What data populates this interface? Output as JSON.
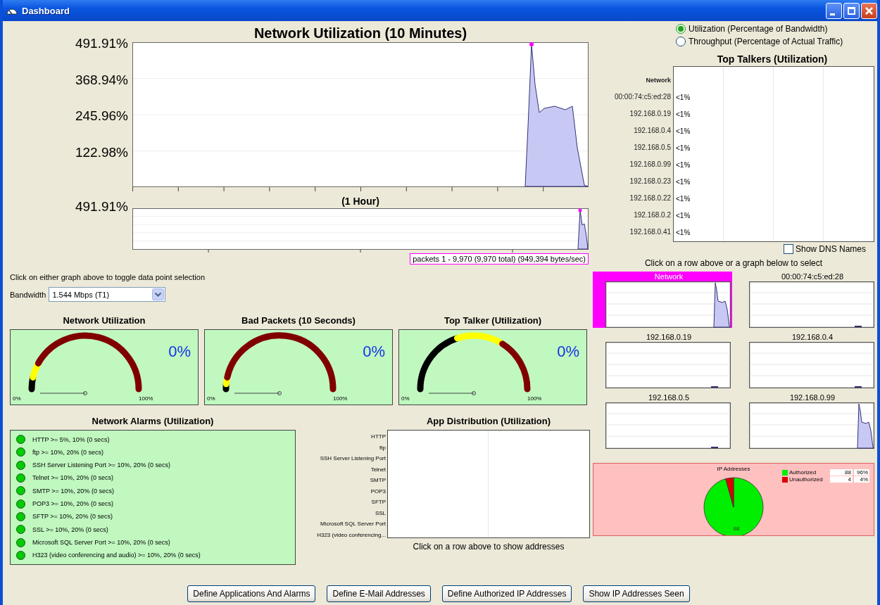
{
  "window": {
    "title": "Dashboard"
  },
  "utilization_chart": {
    "title": "Network Utilization (10 Minutes)",
    "y_labels": [
      "491.91%",
      "368.94%",
      "245.96%",
      "122.98%"
    ]
  },
  "hour_chart": {
    "title": "(1 Hour)",
    "y_labels": [
      "491.91%"
    ],
    "selection": "packets 1 - 9,970 (9,970 total) (949,394 bytes/sec)"
  },
  "hint": "Click on either graph above to toggle data point selection",
  "bandwidth": {
    "label": "Bandwidth",
    "value": "1.544 Mbps (T1)"
  },
  "gauges": [
    {
      "title": "Network Utilization",
      "value": "0%",
      "min_label": "0%",
      "max_label": "100%",
      "kind": "low"
    },
    {
      "title": "Bad Packets (10 Seconds)",
      "value": "0%",
      "min_label": "0%",
      "max_label": "100%",
      "kind": "tight"
    },
    {
      "title": "Top Talker (Utilization)",
      "value": "0%",
      "min_label": "0%",
      "max_label": "100%",
      "kind": "wide"
    }
  ],
  "alarms": {
    "title": "Network Alarms (Utilization)",
    "items": [
      "HTTP >= 5%, 10% (0 secs)",
      "ftp >= 10%, 20% (0 secs)",
      "SSH Server Listening Port >= 10%, 20% (0 secs)",
      "Telnet >= 10%, 20% (0 secs)",
      "SMTP >= 10%, 20% (0 secs)",
      "POP3 >= 10%, 20% (0 secs)",
      "SFTP >= 10%, 20% (0 secs)",
      "SSL >= 10%, 20% (0 secs)",
      "Microsoft SQL Server Port >= 10%, 20% (0 secs)",
      "H323 (video conferencing and audio) >= 10%, 20% (0 secs)"
    ]
  },
  "app_distribution": {
    "title": "App Distribution (Utilization)",
    "rows": [
      "HTTP",
      "ftp",
      "SSH Server Listening Port",
      "Telnet",
      "SMTP",
      "POP3",
      "SFTP",
      "SSL",
      "Microsoft SQL Server Port",
      "H323 (video conferencing..."
    ],
    "caption": "Click on a row above to show addresses"
  },
  "modes": [
    {
      "label": "Utilization (Percentage of Bandwidth)",
      "selected": true
    },
    {
      "label": "Throughput (Percentage of Actual Traffic)",
      "selected": false
    }
  ],
  "top_talkers": {
    "title": "Top Talkers (Utilization)",
    "rows": [
      {
        "label": "Network"
      },
      {
        "label": "00:00:74:c5:ed:28",
        "value": "<1%"
      },
      {
        "label": "192.168.0.19",
        "value": "<1%"
      },
      {
        "label": "192.168.0.4",
        "value": "<1%"
      },
      {
        "label": "192.168.0.5",
        "value": "<1%"
      },
      {
        "label": "192.168.0.99",
        "value": "<1%"
      },
      {
        "label": "192.168.0.23",
        "value": "<1%"
      },
      {
        "label": "192.168.0.22",
        "value": "<1%"
      },
      {
        "label": "192.168.0.2",
        "value": "<1%"
      },
      {
        "label": "192.168.0.41",
        "value": "<1%"
      }
    ]
  },
  "show_dns_names": {
    "label": "Show DNS Names",
    "checked": false
  },
  "select_hint": "Click on a row above or a graph below to select",
  "host_graphs": [
    {
      "title": "Network",
      "selected": true,
      "kind": "spike"
    },
    {
      "title": "00:00:74:c5:ed:28",
      "selected": false,
      "kind": "blip"
    },
    {
      "title": "192.168.0.19",
      "selected": false,
      "kind": "blip"
    },
    {
      "title": "192.168.0.4",
      "selected": false,
      "kind": "blip"
    },
    {
      "title": "192.168.0.5",
      "selected": false,
      "kind": "blip"
    },
    {
      "title": "192.168.0.99",
      "selected": false,
      "kind": "spike"
    }
  ],
  "ip_addresses": {
    "title": "IP Addresses",
    "slice_label": "88",
    "legend": [
      {
        "label": "Authorized",
        "count": "88",
        "percent": "96%",
        "color": "#00ee00"
      },
      {
        "label": "Unauthorized",
        "count": "4",
        "percent": "4%",
        "color": "#dd0000"
      }
    ]
  },
  "buttons": [
    "Define Applications And Alarms",
    "Define E-Mail Addresses",
    "Define Authorized IP Addresses",
    "Show IP Addresses Seen"
  ]
}
